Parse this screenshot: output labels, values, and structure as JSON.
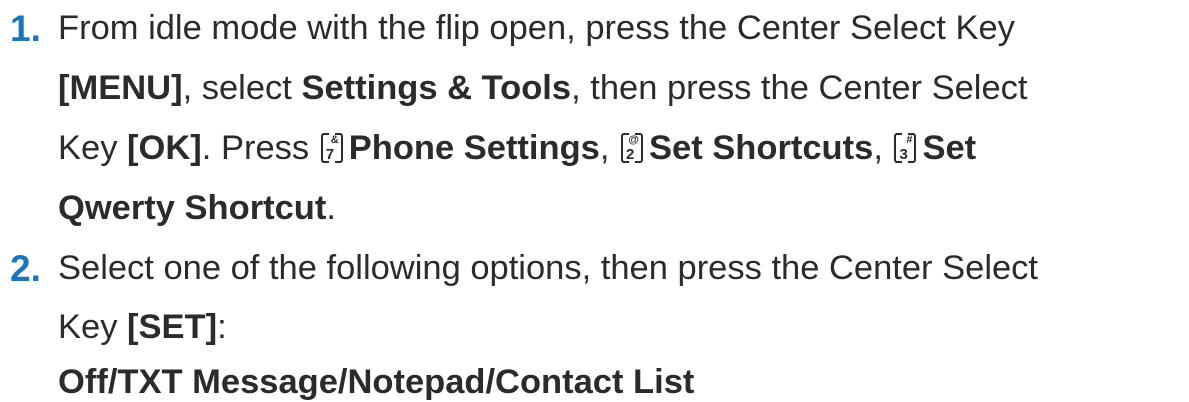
{
  "steps": [
    {
      "number": "1.",
      "line1": "From idle mode with the flip open, press the Center Select Key",
      "line2_b1": "[MENU]",
      "line2_t1": ", select ",
      "line2_b2": "Settings & Tools",
      "line2_t2": ", then press the Center Select",
      "line3_t1": "Key ",
      "line3_b1": "[OK]",
      "line3_t2": ". Press ",
      "key1_digit": "7",
      "key1_symbol": "&",
      "line3_b2": "Phone Settings",
      "line3_t3": ", ",
      "key2_digit": "2",
      "key2_symbol": "@",
      "line3_b3": "Set Shortcuts",
      "line3_t4": ", ",
      "key3_digit": "3",
      "key3_symbol": "#",
      "line3_b4": "Set",
      "line4_b1": "Qwerty Shortcut",
      "line4_t1": "."
    },
    {
      "number": "2.",
      "line1": "Select one of the following options, then press the Center Select",
      "line2_t1": "Key ",
      "line2_b1": "[SET]",
      "line2_t2": ":",
      "line3_b1": "Off/TXT Message/Notepad/Contact List"
    }
  ]
}
